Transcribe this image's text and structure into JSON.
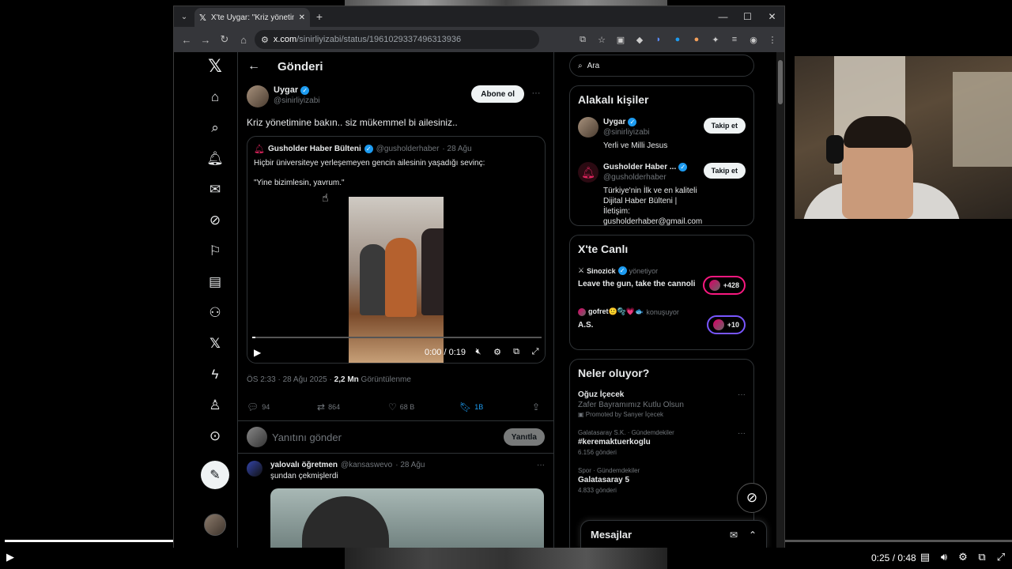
{
  "browser": {
    "tab_title": "X'te Uygar: \"Kriz yönetimine ba",
    "url_host": "x.com",
    "url_path": "/sinirliyizabi/status/1961029337496313936"
  },
  "nav": {
    "page_title": "Gönderi"
  },
  "tweet": {
    "author_name": "Uygar",
    "author_handle": "@sinirliyizabi",
    "subscribe_label": "Abone ol",
    "text": "Kriz yönetimine bakın.. siz mükemmel bi ailesiniz..",
    "quote": {
      "author_name": "Gusholder Haber Bülteni",
      "author_handle": "@gusholderhaber",
      "date": "· 28 Ağu",
      "text1": "Hiçbir üniversiteye yerleşemeyen gencin ailesinin yaşadığı sevinç:",
      "text2": "\"Yine bizimlesin, yavrum.\"",
      "video_time": "0:00 / 0:19",
      "video_progress": 0.0
    },
    "meta_time": "ÖS 2:33 · 28 Ağu 2025 · ",
    "views_count": "2,2 Mn",
    "views_label": " Görüntülenme",
    "replies": "94",
    "reposts": "864",
    "likes": "68 B",
    "bookmarks": "1B",
    "reply_placeholder": "Yanıtını gönder",
    "reply_button": "Yanıtla"
  },
  "reply2": {
    "author_name": "yalovalı öğretmen",
    "author_handle": "@kansaswevo",
    "date": "· 28 Ağu",
    "text": "şundan çekmişlerdi"
  },
  "right": {
    "search_placeholder": "Ara",
    "related_title": "Alakalı kişiler",
    "people": [
      {
        "name": "Uygar",
        "handle": "@sinirliyizabi",
        "bio": "Yerli ve Milli Jesus",
        "follow": "Takip et"
      },
      {
        "name": "Gusholder Haber ...",
        "handle": "@gusholderhaber",
        "bio": "Türkiye'nin İlk ve en kaliteli Dijital Haber Bülteni | İletişim: gusholderhaber@gmail.com",
        "follow": "Takip et"
      }
    ],
    "live_title": "X'te Canlı",
    "live": [
      {
        "host": "Sinozick",
        "role": "yönetiyor",
        "title": "Leave the gun, take the cannoli",
        "count": "+428"
      },
      {
        "host": "gofret🙂🫧💗🐟",
        "role": "konuşuyor",
        "title": "A.S.",
        "count": "+10"
      }
    ],
    "trends_title": "Neler oluyor?",
    "trends": [
      {
        "context": "",
        "name": "Oğuz İçecek",
        "desc": "Zafer Bayramımız Kutlu Olsun",
        "promo": "Promoted by Sanyer İçecek",
        "count": ""
      },
      {
        "context": "Galatasaray S.K. · Gündemdekiler",
        "name": "#keremaktuerkoglu",
        "desc": "",
        "promo": "",
        "count": "6.156 gönderi"
      },
      {
        "context": "Spor · Gündemdekiler",
        "name": "Galatasaray 5",
        "desc": "",
        "promo": "",
        "count": "4.833 gönderi"
      }
    ],
    "messages_title": "Mesajlar"
  },
  "player": {
    "time": "0:25 / 0:48",
    "progress": 0.52
  }
}
